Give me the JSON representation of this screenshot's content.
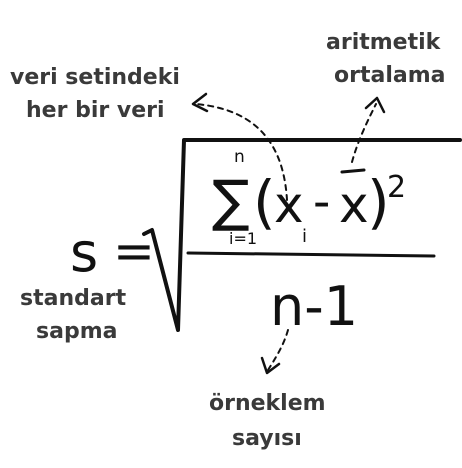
{
  "labels": {
    "data_point": [
      "veri setindeki",
      "her bir veri"
    ],
    "mean": [
      "aritmetik",
      "ortalama"
    ],
    "std_dev": [
      "standart",
      "sapma"
    ],
    "sample_size": [
      "örneklem",
      "sayısı"
    ]
  },
  "formula": {
    "lhs": "s",
    "equals": "=",
    "sigma": "∑",
    "sum_upper": "n",
    "sum_lower": "i=1",
    "open_paren": "(",
    "x": "x",
    "subscript": "i",
    "minus": "-",
    "xbar": "x",
    "close_paren": ")",
    "exponent": "2",
    "denominator": "n-1"
  }
}
